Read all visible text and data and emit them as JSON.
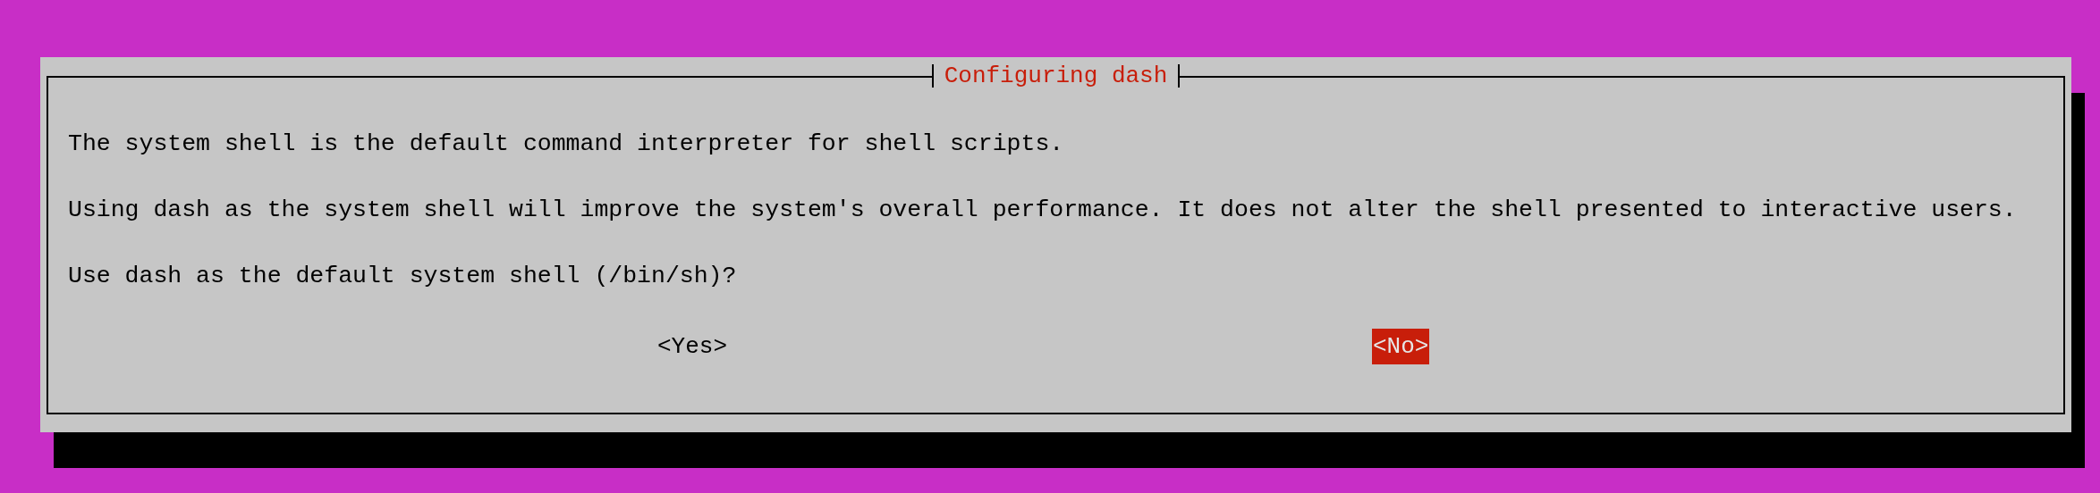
{
  "dialog": {
    "title": "Configuring dash",
    "paragraphs": [
      "The system shell is the default command interpreter for shell scripts.",
      "Using dash as the system shell will improve the system's overall performance. It does not alter the shell presented to interactive users.",
      "Use dash as the default system shell (/bin/sh)?"
    ],
    "buttons": [
      {
        "label": "<Yes>",
        "selected": false
      },
      {
        "label": "<No>",
        "selected": true
      }
    ]
  }
}
